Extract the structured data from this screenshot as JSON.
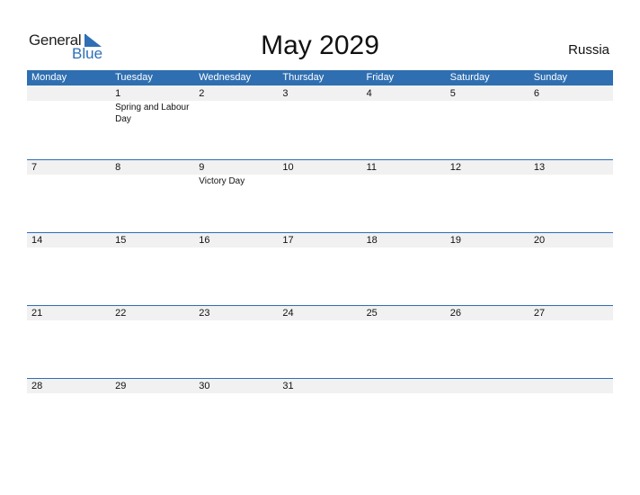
{
  "logo": {
    "general": "General",
    "blue": "Blue"
  },
  "title": "May 2029",
  "country": "Russia",
  "colors": {
    "accent": "#2f6fb1",
    "date_strip": "#f1f1f1"
  },
  "weekdays": [
    "Monday",
    "Tuesday",
    "Wednesday",
    "Thursday",
    "Friday",
    "Saturday",
    "Sunday"
  ],
  "weeks": [
    [
      {
        "day": "",
        "event": ""
      },
      {
        "day": "1",
        "event": "Spring and Labour Day"
      },
      {
        "day": "2",
        "event": ""
      },
      {
        "day": "3",
        "event": ""
      },
      {
        "day": "4",
        "event": ""
      },
      {
        "day": "5",
        "event": ""
      },
      {
        "day": "6",
        "event": ""
      }
    ],
    [
      {
        "day": "7",
        "event": ""
      },
      {
        "day": "8",
        "event": ""
      },
      {
        "day": "9",
        "event": "Victory Day"
      },
      {
        "day": "10",
        "event": ""
      },
      {
        "day": "11",
        "event": ""
      },
      {
        "day": "12",
        "event": ""
      },
      {
        "day": "13",
        "event": ""
      }
    ],
    [
      {
        "day": "14",
        "event": ""
      },
      {
        "day": "15",
        "event": ""
      },
      {
        "day": "16",
        "event": ""
      },
      {
        "day": "17",
        "event": ""
      },
      {
        "day": "18",
        "event": ""
      },
      {
        "day": "19",
        "event": ""
      },
      {
        "day": "20",
        "event": ""
      }
    ],
    [
      {
        "day": "21",
        "event": ""
      },
      {
        "day": "22",
        "event": ""
      },
      {
        "day": "23",
        "event": ""
      },
      {
        "day": "24",
        "event": ""
      },
      {
        "day": "25",
        "event": ""
      },
      {
        "day": "26",
        "event": ""
      },
      {
        "day": "27",
        "event": ""
      }
    ],
    [
      {
        "day": "28",
        "event": ""
      },
      {
        "day": "29",
        "event": ""
      },
      {
        "day": "30",
        "event": ""
      },
      {
        "day": "31",
        "event": ""
      },
      {
        "day": "",
        "event": ""
      },
      {
        "day": "",
        "event": ""
      },
      {
        "day": "",
        "event": ""
      }
    ]
  ]
}
